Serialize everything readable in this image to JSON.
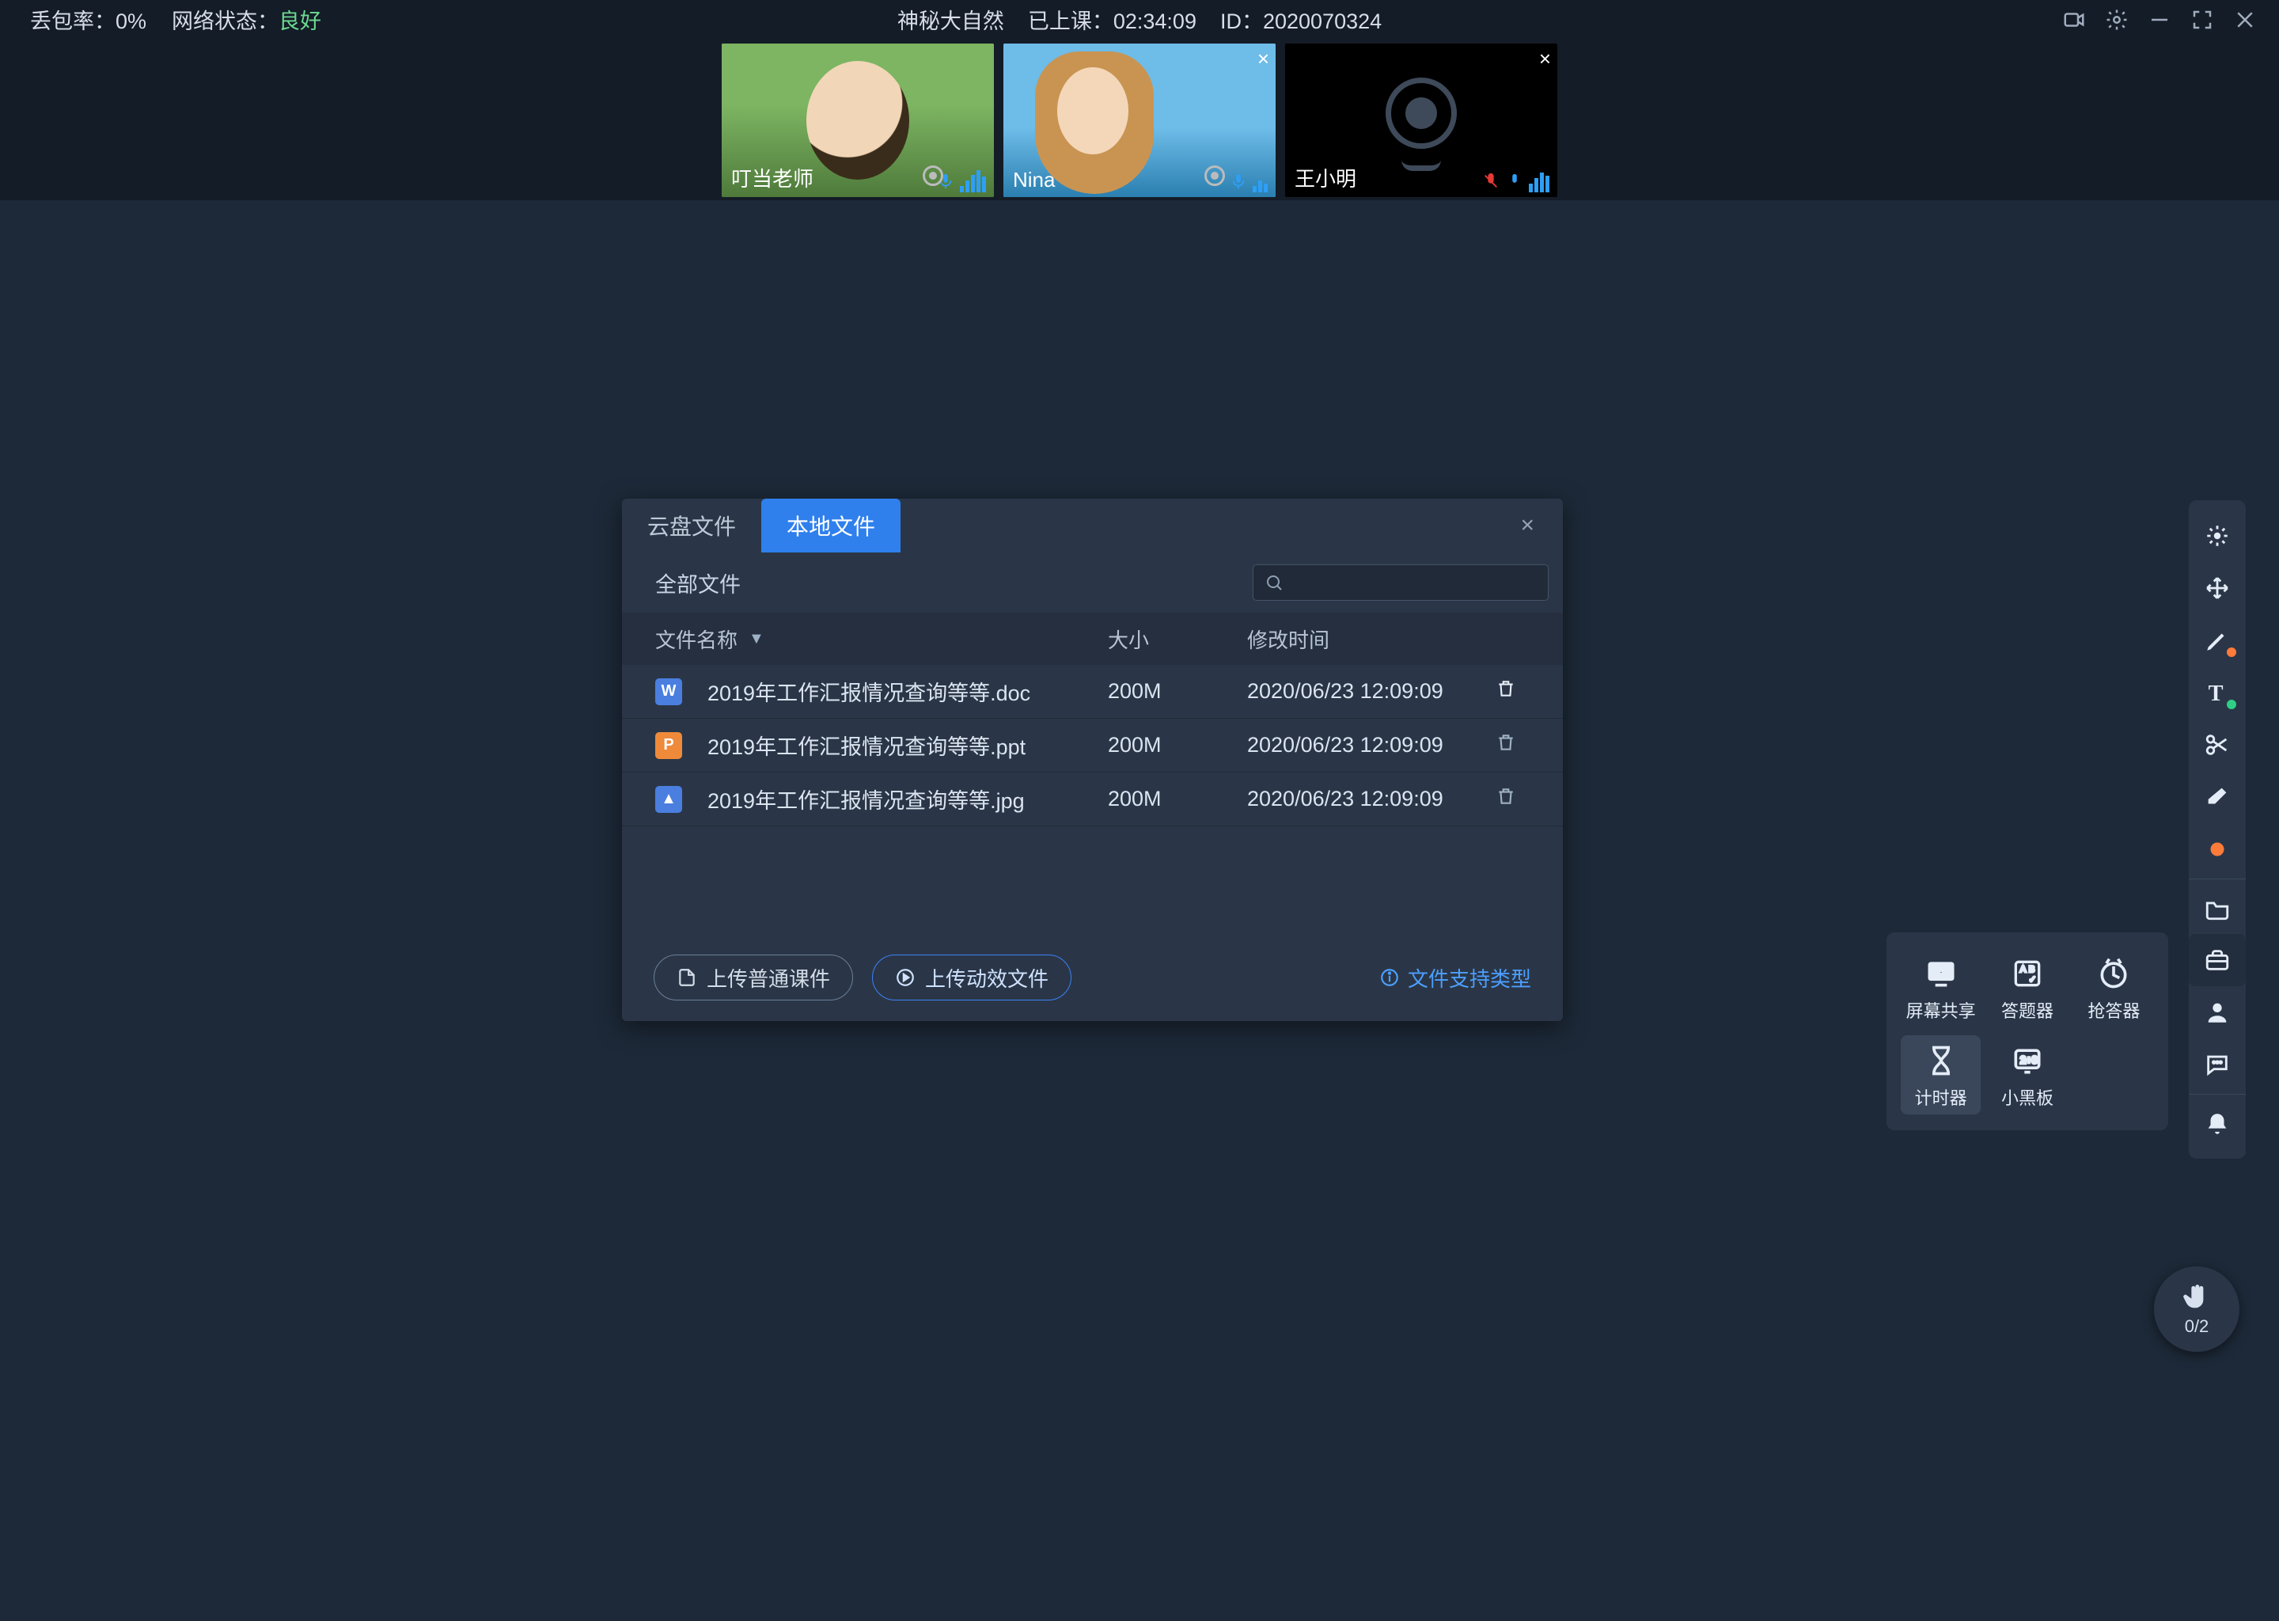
{
  "topbar": {
    "packet_loss_label": "丢包率：",
    "packet_loss_value": "0%",
    "net_label": "网络状态：",
    "net_value": "良好",
    "title": "神秘大自然",
    "elapsed_label": "已上课：",
    "elapsed_value": "02:34:09",
    "id_label": "ID：",
    "id_value": "2020070324"
  },
  "videos": [
    {
      "name": "叮当老师",
      "camera": "on",
      "style": "person1",
      "closable": false,
      "audio_level": 5,
      "mic": "on"
    },
    {
      "name": "Nina",
      "camera": "on",
      "style": "person2",
      "closable": true,
      "audio_level": 3,
      "mic": "on"
    },
    {
      "name": "王小明",
      "camera": "off",
      "style": "cam-off",
      "closable": true,
      "audio_level": 4,
      "mic": "muted"
    }
  ],
  "dialog": {
    "tab_cloud": "云盘文件",
    "tab_local": "本地文件",
    "filter_all": "全部文件",
    "headers": {
      "name": "文件名称",
      "size": "大小",
      "date": "修改时间"
    },
    "files": [
      {
        "icon": "doc",
        "name": "2019年工作汇报情况查询等等.doc",
        "size": "200M",
        "date": "2020/06/23 12:09:09"
      },
      {
        "icon": "ppt",
        "name": "2019年工作汇报情况查询等等.ppt",
        "size": "200M",
        "date": "2020/06/23 12:09:09"
      },
      {
        "icon": "img",
        "name": "2019年工作汇报情况查询等等.jpg",
        "size": "200M",
        "date": "2020/06/23 12:09:09"
      }
    ],
    "btn_upload_normal": "上传普通课件",
    "btn_upload_anim": "上传动效文件",
    "info": "文件支持类型"
  },
  "popup": {
    "items": [
      {
        "key": "screen",
        "label": "屏幕共享"
      },
      {
        "key": "quiz",
        "label": "答题器"
      },
      {
        "key": "buzzer",
        "label": "抢答器"
      },
      {
        "key": "timer",
        "label": "计时器",
        "highlight": true
      },
      {
        "key": "board",
        "label": "小黑板"
      }
    ]
  },
  "hand": {
    "count": "0/2"
  },
  "file_icon_text": {
    "doc": "W",
    "ppt": "P",
    "img": "▲"
  }
}
